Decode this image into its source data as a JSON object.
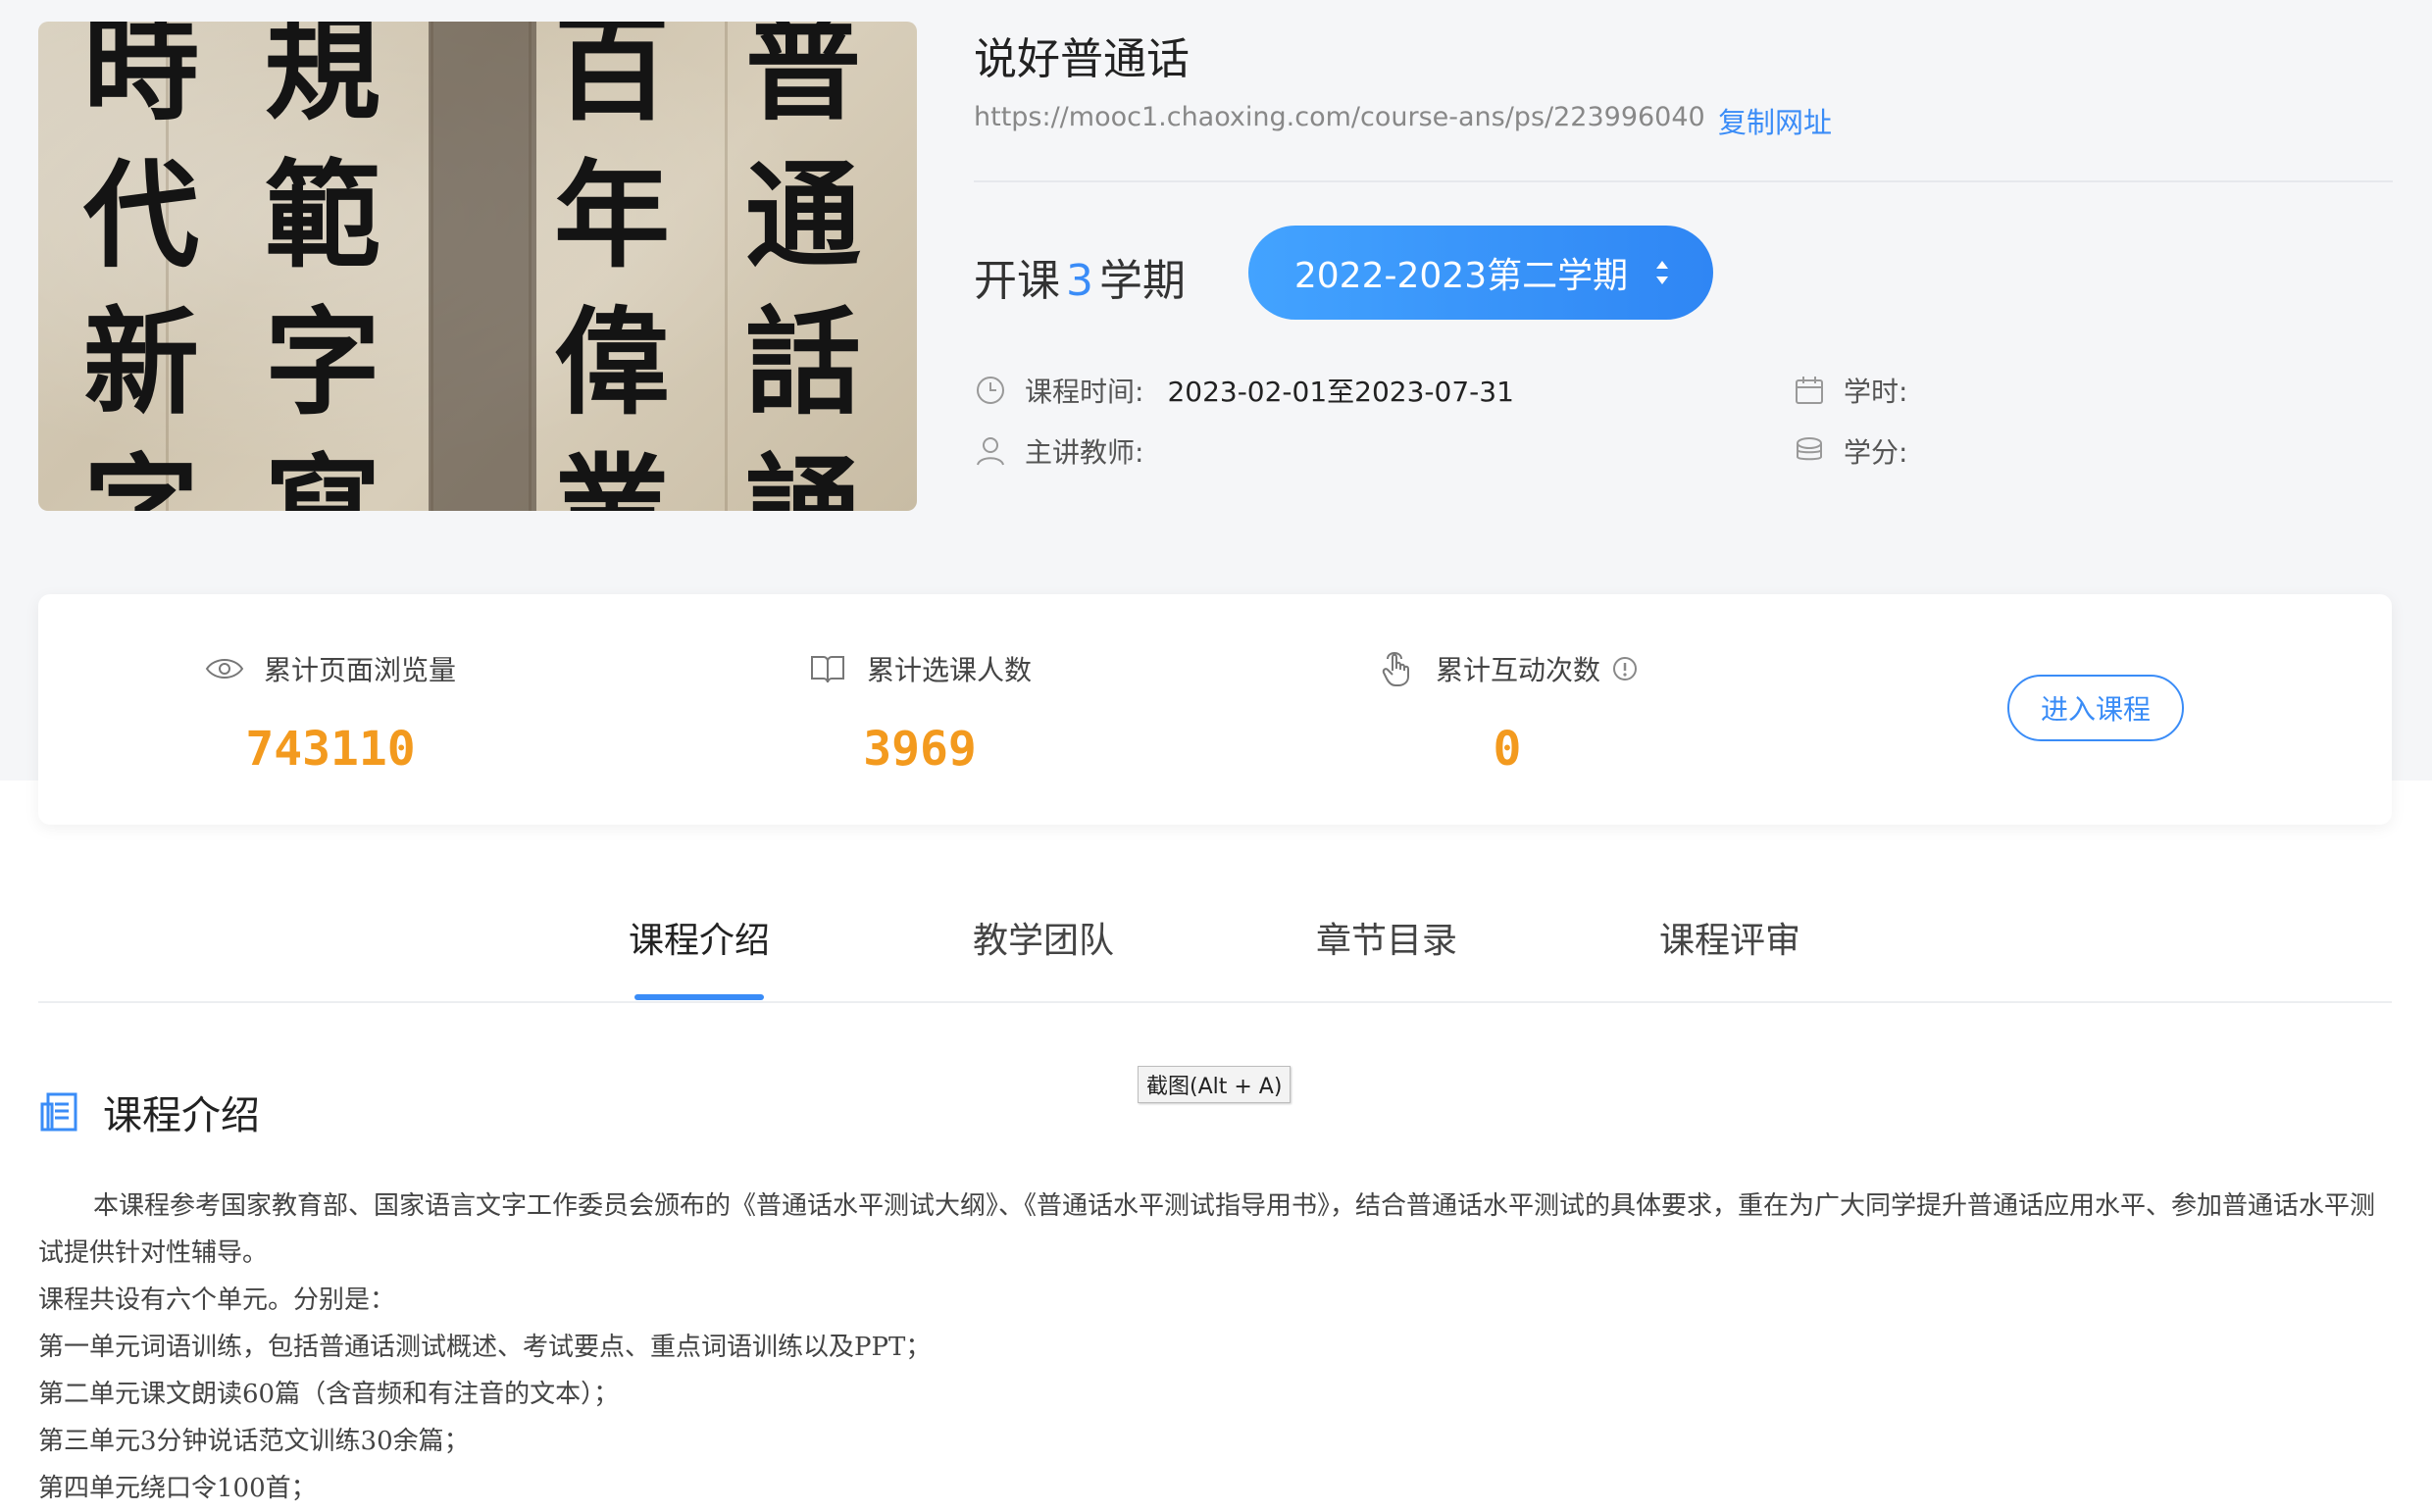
{
  "course": {
    "title": "说好普通话",
    "url": "https://mooc1.chaoxing.com/course-ans/ps/223996040",
    "copy_label": "复制网址",
    "cover_chars": [
      [
        "時",
        "代",
        "新",
        "字"
      ],
      [
        "規",
        "範",
        "字",
        "寫"
      ],
      [
        "百",
        "年",
        "偉",
        "業"
      ],
      [
        "普",
        "通",
        "話",
        "誦"
      ]
    ]
  },
  "semester": {
    "prefix": "开课",
    "count": "3",
    "suffix": "学期",
    "selected": "2022-2023第二学期"
  },
  "meta": {
    "time_label": "课程时间:",
    "time_value": "2023-02-01至2023-07-31",
    "teacher_label": "主讲教师:",
    "teacher_value": "",
    "hours_label": "学时:",
    "hours_value": "",
    "credit_label": "学分:",
    "credit_value": ""
  },
  "stats": {
    "views_label": "累计页面浏览量",
    "views_value": "743110",
    "enroll_label": "累计选课人数",
    "enroll_value": "3969",
    "interact_label": "累计互动次数",
    "interact_value": "0",
    "enter_label": "进入课程"
  },
  "tabs": [
    {
      "label": "课程介绍"
    },
    {
      "label": "教学团队"
    },
    {
      "label": "章节目录"
    },
    {
      "label": "课程评审"
    }
  ],
  "tooltip": "截图(Alt + A)",
  "intro": {
    "title": "课程介绍",
    "paragraphs": [
      "本课程参考国家教育部、国家语言文字工作委员会颁布的《普通话水平测试大纲》、《普通话水平测试指导用书》，结合普通话水平测试的具体要求，重在为广大同学提升普通话应用水平、参加普通话水平测试提供针对性辅导。",
      "课程共设有六个单元。分别是：",
      "第一单元词语训练，包括普通话测试概述、考试要点、重点词语训练以及PPT；",
      "第二单元课文朗读60篇（含音频和有注音的文本）；",
      "第三单元3分钟说话范文训练30余篇；",
      "第四单元绕口令100首；"
    ]
  },
  "colors": {
    "accent": "#3a8cf7",
    "stat_value": "#f39a1e",
    "top_background": "#f5f6f8"
  }
}
